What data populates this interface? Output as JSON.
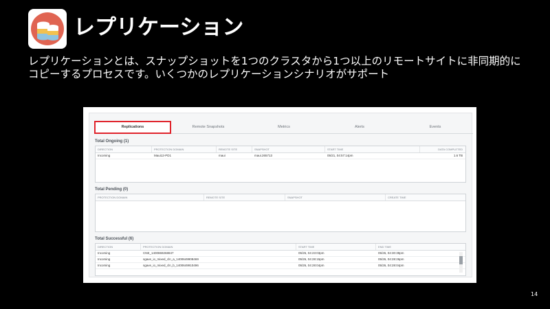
{
  "slide": {
    "title": "レプリケーション",
    "description": "レプリケーションとは、スナップショットを1つのクラスタから1つ以上のリモートサイトに非同期的にコピーするプロセスです。いくつかのレプリケーションシナリオがサポート",
    "page_number": "14",
    "logo_icon": "database-icon",
    "colors": {
      "logo_bg": "#e06452",
      "highlight": "#e0232b"
    }
  },
  "tabs": [
    "Replications",
    "Remote Snapshots",
    "Metrics",
    "Alerts",
    "Events"
  ],
  "ongoing": {
    "title": "Total Ongoing (1)",
    "headers": [
      "DIRECTION",
      "PROTECTION DOMAIN",
      "REMOTE SITE",
      "SNAPSHOT",
      "START TIME",
      "DATA COMPLETED"
    ],
    "rows": [
      [
        "Incoming",
        "Maui12-PD1",
        "maui",
        "maui.265713",
        "05/21, 04:57:14pm",
        "1.6 TB"
      ]
    ]
  },
  "pending": {
    "title": "Total Pending (0)",
    "headers": [
      "PROTECTION DOMAIN",
      "REMOTE SITE",
      "SNAPSHOT",
      "CREATE TIME"
    ]
  },
  "successful": {
    "title": "Total Successful (6)",
    "headers": [
      "DIRECTION",
      "PROTECTION DOMAIN",
      "START TIME",
      "END TIME"
    ],
    "rows": [
      [
        "Incoming",
        "CNE_1400869268847",
        "05/26, 04:23:03pm",
        "05/26, 04:30:39pm"
      ],
      [
        "Incoming",
        "sgave_io_mixed_cln_a_1400649908469",
        "05/26, 04:28:15pm",
        "05/26, 04:28:26pm"
      ],
      [
        "Incoming",
        "sgave_io_mixed_cln_b_1400649910496",
        "05/26, 04:28:04pm",
        "05/26, 04:28:04pm"
      ]
    ]
  }
}
